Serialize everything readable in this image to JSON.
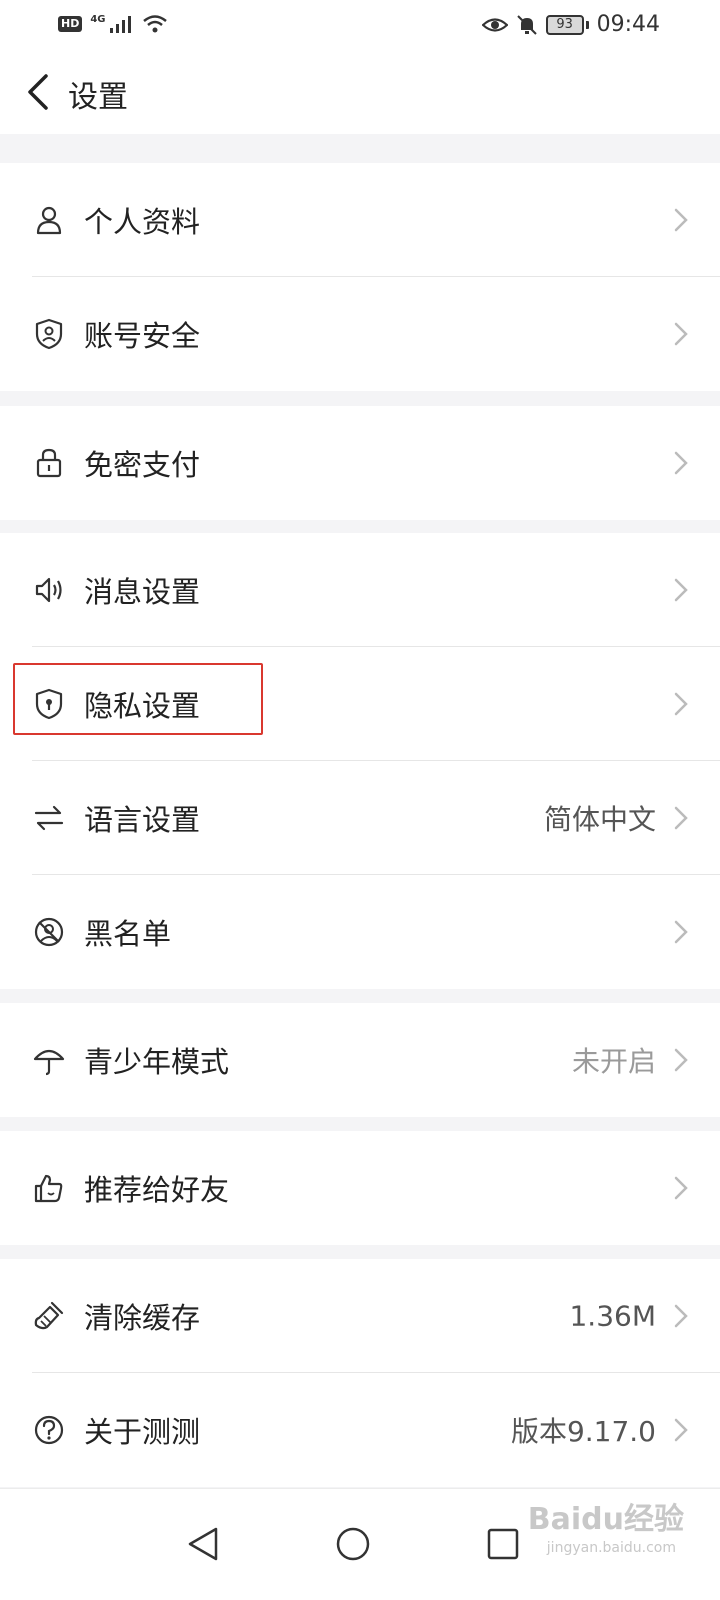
{
  "status_bar": {
    "hd": "HD",
    "network": "4G",
    "battery": "93",
    "time": "09:44"
  },
  "header": {
    "title": "设置",
    "back_icon": "chevron-left-icon"
  },
  "groups": [
    {
      "items": [
        {
          "label": "个人资料",
          "icon": "person-icon"
        },
        {
          "label": "账号安全",
          "icon": "shield-person-icon"
        }
      ]
    },
    {
      "items": [
        {
          "label": "免密支付",
          "icon": "lock-icon"
        }
      ]
    },
    {
      "items": [
        {
          "label": "消息设置",
          "icon": "speaker-icon"
        },
        {
          "label": "隐私设置",
          "icon": "shield-keyhole-icon",
          "highlighted": true
        },
        {
          "label": "语言设置",
          "value": "简体中文",
          "icon": "swap-arrows-icon"
        },
        {
          "label": "黑名单",
          "icon": "blocked-user-icon"
        }
      ]
    },
    {
      "items": [
        {
          "label": "青少年模式",
          "value": "未开启",
          "icon": "umbrella-icon"
        }
      ]
    },
    {
      "items": [
        {
          "label": "推荐给好友",
          "icon": "thumbs-up-icon"
        }
      ]
    },
    {
      "items": [
        {
          "label": "清除缓存",
          "value": "1.36M",
          "icon": "broom-icon"
        },
        {
          "label": "关于测测",
          "value": "版本9.17.0",
          "icon": "question-circle-icon"
        }
      ]
    }
  ],
  "nav_bar": {
    "back_icon": "triangle-back-icon",
    "home_icon": "circle-home-icon",
    "recent_icon": "square-recent-icon"
  },
  "watermark": {
    "text": "Baidu经验",
    "sub": "jingyan.baidu.com"
  },
  "colors": {
    "highlight": "#d9382f",
    "background": "#f4f4f6",
    "muted_value": "#9a9a9a"
  }
}
